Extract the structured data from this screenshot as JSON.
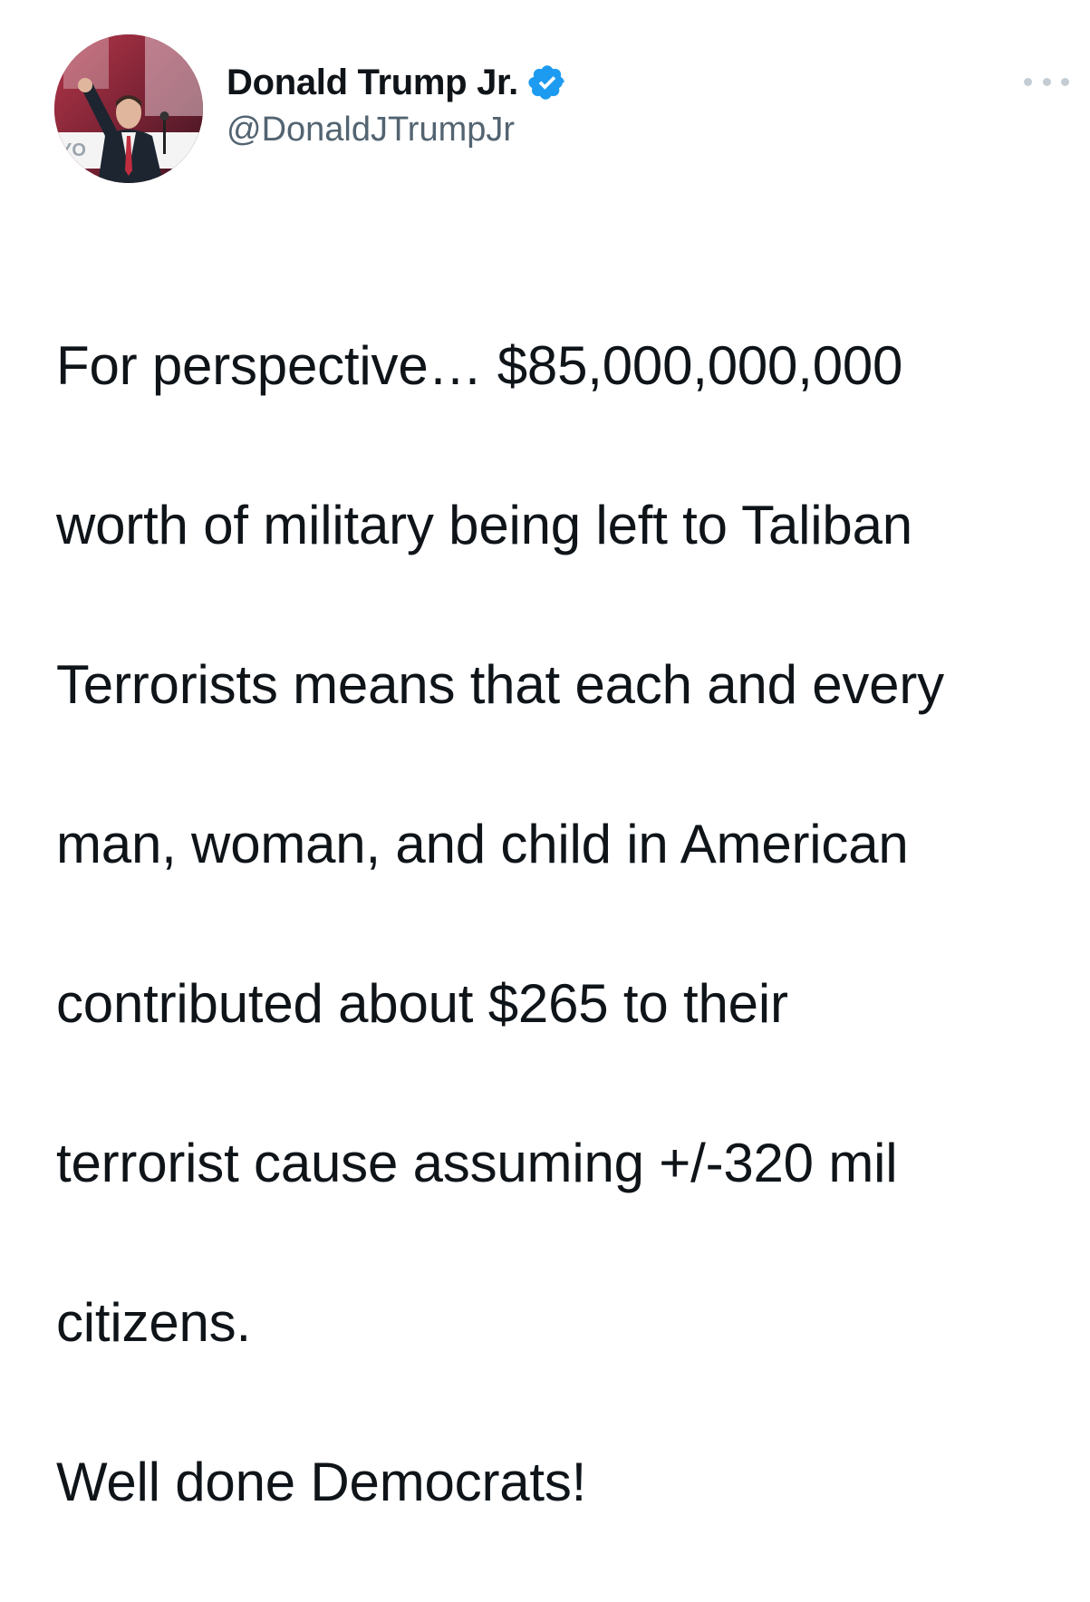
{
  "tweet": {
    "author": {
      "display_name": "Donald Trump Jr.",
      "handle": "@DonaldJTrumpJr",
      "verified": true,
      "avatar_icon": "profile-photo",
      "avatar_sign_text": "YO"
    },
    "menu_icon": "more-options-icon",
    "text_lines": [
      "For perspective… $85,000,000,000",
      "worth of military being left to Taliban",
      "Terrorists means that each and every",
      "man, woman, and child in American",
      "contributed about $265 to their",
      "terrorist cause assuming +/-320 mil",
      "citizens.",
      "Well done Democrats!"
    ]
  },
  "colors": {
    "text": "#0f1419",
    "handle": "#536471",
    "verified": "#1d9bf0",
    "menu_dots": "#c4cdd4",
    "background": "#ffffff"
  }
}
